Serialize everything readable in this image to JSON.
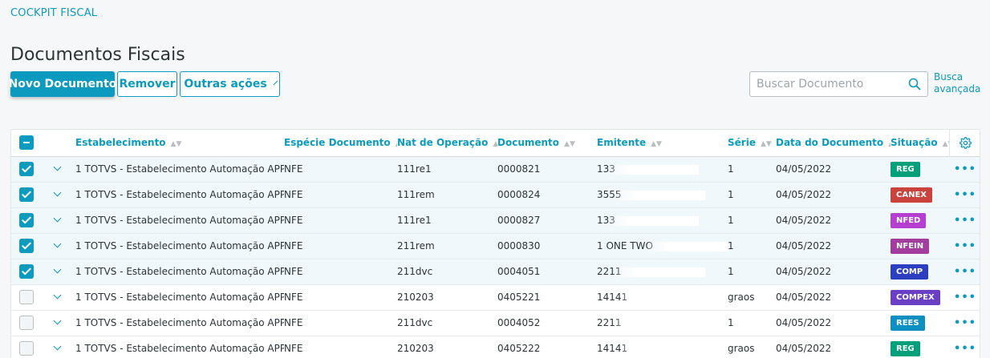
{
  "app": {
    "name": "COCKPIT FISCAL"
  },
  "page": {
    "title": "Documentos Fiscais"
  },
  "actions": {
    "new_label": "Novo Documento",
    "remove_label": "Remover",
    "more_label": "Outras ações"
  },
  "search": {
    "placeholder": "Buscar Documento",
    "value": "",
    "advanced_label_1": "Busca",
    "advanced_label_2": "avançada"
  },
  "table": {
    "columns": [
      "Estabelecimento",
      "Espécie Documento",
      "Nat de Operação",
      "Documento",
      "Emitente",
      "Série",
      "Data do Documento",
      "Situação"
    ],
    "rows": [
      {
        "selected": true,
        "estab": "1 TOTVS - Estabelecimento Automação APP",
        "especie": "NFE",
        "nat": "111re1",
        "doc": "0000821",
        "emitente": "133",
        "serie": "1",
        "data": "04/05/2022",
        "situacao": "REG",
        "color": "#00a07a"
      },
      {
        "selected": true,
        "estab": "1 TOTVS - Estabelecimento Automação APP",
        "especie": "NFE",
        "nat": "111rem",
        "doc": "0000824",
        "emitente": "3555",
        "serie": "1",
        "data": "04/05/2022",
        "situacao": "CANEX",
        "color": "#c9423b"
      },
      {
        "selected": true,
        "estab": "1 TOTVS - Estabelecimento Automação APP",
        "especie": "NFE",
        "nat": "111re1",
        "doc": "0000827",
        "emitente": "133",
        "serie": "1",
        "data": "04/05/2022",
        "situacao": "NFED",
        "color": "#b43fd1"
      },
      {
        "selected": true,
        "estab": "1 TOTVS - Estabelecimento Automação APP",
        "especie": "NFE",
        "nat": "211rem",
        "doc": "0000830",
        "emitente": "1 ONE TWO",
        "serie": "1",
        "data": "04/05/2022",
        "situacao": "NFEIN",
        "color": "#a23d9e"
      },
      {
        "selected": true,
        "estab": "1 TOTVS - Estabelecimento Automação APP",
        "especie": "NFE",
        "nat": "211dvc",
        "doc": "0004051",
        "emitente": "2211",
        "serie": "1",
        "data": "04/05/2022",
        "situacao": "COMP",
        "color": "#2b3fc0"
      },
      {
        "selected": false,
        "estab": "1 TOTVS - Estabelecimento Automação APP",
        "especie": "NFE",
        "nat": "210203",
        "doc": "0405221",
        "emitente": "14141",
        "serie": "graos",
        "data": "04/05/2022",
        "situacao": "COMPEX",
        "color": "#6b3fc5"
      },
      {
        "selected": false,
        "estab": "1 TOTVS - Estabelecimento Automação APP",
        "especie": "NFE",
        "nat": "211dvc",
        "doc": "0004052",
        "emitente": "2211",
        "serie": "1",
        "data": "04/05/2022",
        "situacao": "REES",
        "color": "#0d8fc1"
      },
      {
        "selected": false,
        "estab": "1 TOTVS - Estabelecimento Automação APP",
        "especie": "NFE",
        "nat": "210203",
        "doc": "0405222",
        "emitente": "14141",
        "serie": "graos",
        "data": "04/05/2022",
        "situacao": "REG",
        "color": "#00a07a"
      }
    ]
  },
  "icons": {
    "search": "search-icon",
    "settings": "gear-icon",
    "row_menu": "more-horizontal-icon",
    "expand": "chevron-down-icon"
  },
  "colors": {
    "primary": "#0c9abe"
  }
}
